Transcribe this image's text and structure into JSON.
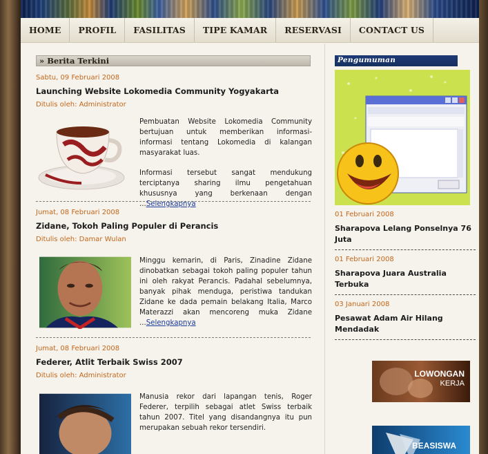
{
  "nav": {
    "items": [
      "HOME",
      "PROFIL",
      "FASILITAS",
      "TIPE KAMAR",
      "RESERVASI",
      "CONTACT US"
    ]
  },
  "main": {
    "section_title": "» Berita Terkini",
    "articles": [
      {
        "date": "Sabtu, 09 Februari 2008",
        "title": "Launching Website Lokomedia Community Yogyakarta",
        "author": "Ditulis oleh: Administrator",
        "paragraph1": "Pembuatan Website Lokomedia Community bertujuan untuk memberikan informasi-informasi tentang Lokomedia di kalangan masyarakat luas.",
        "paragraph2": "Informasi tersebut sangat mendukung terciptanya sharing ilmu pengetahuan khususnya yang berkenaan dengan ...",
        "more": "Selengkapnya",
        "image_icon": "coffee-cup-icon"
      },
      {
        "date": "Jumat, 08 Februari 2008",
        "title": "Zidane, Tokoh Paling Populer di Perancis",
        "author": "Ditulis oleh: Damar Wulan",
        "paragraph1": "Minggu kemarin, di Paris, Zinadine Zidane dinobatkan sebagai tokoh paling populer tahun ini oleh rakyat Perancis. Padahal sebelumnya, banyak pihak menduga, peristiwa tandukan Zidane ke dada pemain belakang Italia, Marco Materazzi akan mencoreng muka Zidane ...",
        "more": "Selengkapnya",
        "image_icon": "portrait-photo-icon"
      },
      {
        "date": "Jumat, 08 Februari 2008",
        "title": "Federer, Atlit Terbaik Swiss 2007",
        "author": "Ditulis oleh: Administrator",
        "paragraph1": "Manusia rekor dari lapangan tenis, Roger Federer, terpilih sebagai atlet Swiss terbaik tahun 2007. Titel yang disandangnya itu pun merupakan sebuah rekor tersendiri.",
        "image_icon": "portrait-photo-icon"
      }
    ]
  },
  "sidebar": {
    "heading": "Pengumuman",
    "news": [
      {
        "date": "01 Februari 2008",
        "title": "Sharapova Lelang Ponselnya 76 Juta"
      },
      {
        "date": "01 Februari 2008",
        "title": "Sharapova Juara Australia Terbuka"
      },
      {
        "date": "03 Januari 2008",
        "title": "Pesawat Adam Air Hilang Mendadak"
      }
    ],
    "promo1": {
      "line1": "LOWONGAN",
      "line2": "KERJA"
    },
    "promo2": {
      "label": "BEASISWA"
    }
  },
  "colors": {
    "date_orange": "#c3661a",
    "link_blue": "#1a3a9a",
    "sidebar_head_bg": "#1e3a75",
    "page_bg": "#f6f3ec"
  }
}
